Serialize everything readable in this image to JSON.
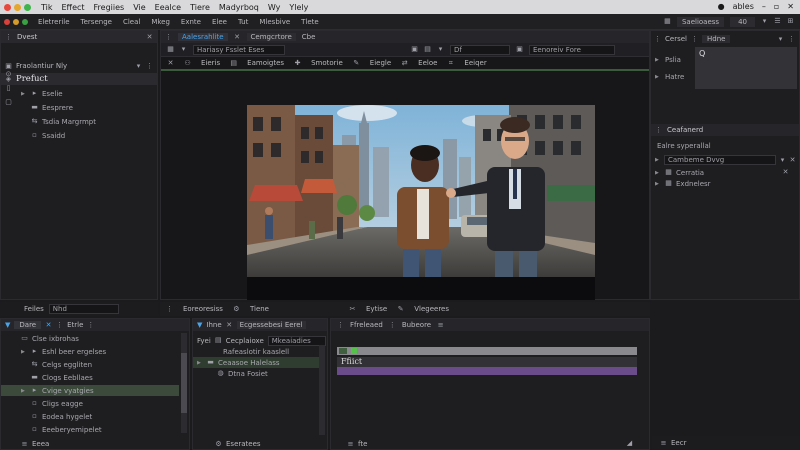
{
  "window": {
    "menu": [
      "Tik",
      "Effect",
      "Fregiies",
      "Vie",
      "Eealce",
      "Tiere",
      "Madyrboq",
      "Wy",
      "Ylely"
    ],
    "right_label": "ables",
    "window_controls": [
      "minimize-icon",
      "restore-icon",
      "close-icon"
    ]
  },
  "toolbar": {
    "items": [
      "Eletrerile",
      "Tersenge",
      "Cleal",
      "Mkeg",
      "Exnte",
      "Elee",
      "Tut",
      "Mlesbive",
      "Tlete"
    ],
    "right_tab": "Saelioaess",
    "right_value": "40"
  },
  "left_panel": {
    "tab": "Dvest",
    "search_label": "Fraolantiur Nly",
    "root": "Prefuct",
    "items": [
      {
        "label": "Eselie",
        "icon": "arrow-icon"
      },
      {
        "label": "Eesprere",
        "icon": "folder-icon"
      },
      {
        "label": "Tsdia Margrmpt",
        "icon": "arrows-icon"
      },
      {
        "label": "Ssaidd",
        "icon": "file-icon"
      }
    ],
    "filter_label": "Feiles",
    "filter_value": "Nhd"
  },
  "viewer": {
    "tabs": [
      "Aalesrahlite",
      "Cemgcrtore",
      "Cbe"
    ],
    "source": "Hariasy Fsslet Eses",
    "timecode": "Df",
    "preset": "Eenoreiv Fore",
    "tools": [
      "Eieris",
      "Eamoigtes",
      "Smotorie",
      "Eiegle",
      "Eeloe",
      "Eeiqer"
    ]
  },
  "right_panel": {
    "tabs": [
      "Cersel",
      "Hdne"
    ],
    "rows": [
      "Pslia",
      "Hatre"
    ],
    "search_value": "Q",
    "effects_title": "Ceafanerd",
    "effects_sub": "Ealre syperallal",
    "effects_field": "Cambeme Dvvg",
    "effects_items": [
      "Cerratia",
      "Exdnelesr"
    ],
    "footer": "Eecr"
  },
  "timeline_bar": {
    "items": [
      "Eoreoresiss",
      "Tiene",
      "Eytise",
      "Vlegeeres"
    ]
  },
  "bottom_left": {
    "tabs": [
      "Dare",
      "Etrle"
    ],
    "root": "Clse ixbrohas",
    "items": [
      {
        "label": "Eshl beer ergelses",
        "indent": 1
      },
      {
        "label": "Celgs eggliten",
        "indent": 1
      },
      {
        "label": "Clogs Eebllaes",
        "indent": 1
      },
      {
        "label": "Cvige vyatgies",
        "indent": 1
      },
      {
        "label": "Cligs eagge",
        "indent": 1
      },
      {
        "label": "Eodea hygelet",
        "indent": 1
      },
      {
        "label": "Eeeberyemipelet",
        "indent": 1
      }
    ],
    "footer": "Eeea"
  },
  "bottom_mid": {
    "tab_a": "Ihne",
    "tab_b": "Ecgessebesi Eerel",
    "header": [
      "Fyei",
      "Cecplaioxe",
      "Mkeaiadies"
    ],
    "sub": "Rafeaslotir kaaslell",
    "rows": [
      "Ceaasoe Halelass",
      "Dtna Fosiet"
    ],
    "footer": "Eseratees"
  },
  "bottom_right": {
    "tabs": [
      "Ffreleaed",
      "Bubeore"
    ],
    "clip_label": "Ffiict",
    "footer": "fte"
  }
}
